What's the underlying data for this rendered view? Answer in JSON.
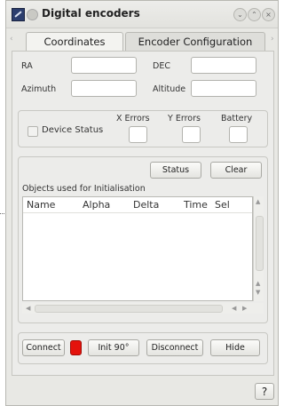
{
  "window": {
    "title": "Digital encoders"
  },
  "tabs": [
    {
      "label": "Coordinates",
      "active": true
    },
    {
      "label": "Encoder Configuration",
      "active": false
    }
  ],
  "coords": {
    "ra_label": "RA",
    "ra_value": "",
    "dec_label": "DEC",
    "dec_value": "",
    "azimuth_label": "Azimuth",
    "azimuth_value": "",
    "altitude_label": "Altitude",
    "altitude_value": ""
  },
  "status_group": {
    "device_status_label": "Device Status",
    "x_errors_label": "X Errors",
    "y_errors_label": "Y Errors",
    "battery_label": "Battery",
    "x_errors_value": "",
    "y_errors_value": "",
    "battery_value": ""
  },
  "init_group": {
    "status_button": "Status",
    "clear_button": "Clear",
    "objects_label": "Objects used for Initialisation",
    "columns": [
      "Name",
      "Alpha",
      "Delta",
      "Time",
      "Sel"
    ]
  },
  "bottom_buttons": {
    "connect": "Connect",
    "init": "Init 90°",
    "disconnect": "Disconnect",
    "hide": "Hide"
  },
  "help_button": "?",
  "colors": {
    "connection_led": "#e4120c"
  }
}
